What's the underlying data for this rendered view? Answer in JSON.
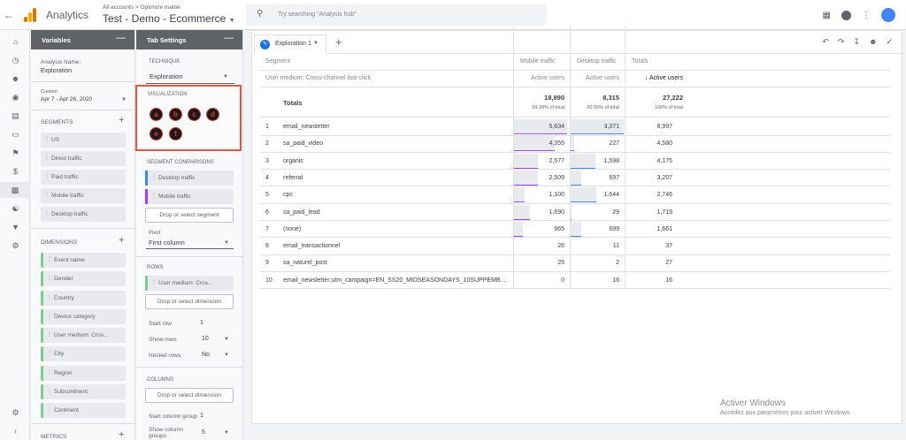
{
  "topbar": {
    "app_name": "Analytics",
    "breadcrumb": "All accounts > Optimize matter",
    "property": "Test - Demo - Ecommerce",
    "search_placeholder": "Try searching \"Analysis hub\""
  },
  "variables": {
    "title": "Variables",
    "analysis_name_label": "Analysis Name:",
    "analysis_name": "Exploration",
    "date_label": "Custom",
    "date_range": "Apr 7 - Apr 26, 2020",
    "segments_label": "SEGMENTS",
    "segments": [
      "US",
      "Direct traffic",
      "Paid traffic",
      "Mobile traffic",
      "Desktop traffic"
    ],
    "dimensions_label": "DIMENSIONS",
    "dimensions": [
      "Event name",
      "Gender",
      "Country",
      "Device category",
      "User medium: Cros...",
      "City",
      "Region",
      "Subcontinent",
      "Continent"
    ],
    "metrics_label": "METRICS"
  },
  "tab_settings": {
    "title": "Tab Settings",
    "technique_label": "TECHNIQUE",
    "technique": "Exploration",
    "visualization_label": "VISUALIZATION",
    "viz_options": [
      "a",
      "b",
      "c",
      "d",
      "e",
      "f"
    ],
    "segment_comparisons_label": "SEGMENT COMPARISONS",
    "segment_comparisons": [
      "Desktop traffic",
      "Mobile traffic"
    ],
    "drop_segment": "Drop or select segment",
    "pivot_label": "Pivot",
    "pivot": "First column",
    "rows_label": "ROWS",
    "row_dimension": "User medium: Cros...",
    "drop_dimension": "Drop or select dimension",
    "start_row_label": "Start row",
    "start_row": "1",
    "show_rows_label": "Show rows",
    "show_rows": "10",
    "nested_rows_label": "Nested rows",
    "nested_rows": "No",
    "columns_label": "COLUMNS",
    "drop_column_dimension": "Drop or select dimension",
    "start_column_group_label": "Start column group",
    "start_column_group": "1",
    "show_column_groups_label": "Show column groups",
    "show_column_groups": "5"
  },
  "exploration": {
    "tab_name": "Exploration 1",
    "segment_header": "Segment",
    "segments": [
      "Mobile traffic",
      "Desktop traffic",
      "Totals"
    ],
    "row_dimension_header": "User medium: Cross-channel last click",
    "metric_headers": [
      "Active users",
      "Active users",
      "↓ Active users"
    ],
    "totals_label": "Totals",
    "totals": [
      {
        "value": "18,890",
        "pct": "69.39% of total"
      },
      {
        "value": "8,315",
        "pct": "30.55% of total"
      },
      {
        "value": "27,222",
        "pct": "100% of total"
      }
    ],
    "rows": [
      {
        "n": "1",
        "name": "email_newsletter",
        "mobile": "5,634",
        "desktop": "3,371",
        "total": "8,997"
      },
      {
        "n": "2",
        "name": "sa_paid_video",
        "mobile": "4,355",
        "desktop": "227",
        "total": "4,580"
      },
      {
        "n": "3",
        "name": "organic",
        "mobile": "2,577",
        "desktop": "1,598",
        "total": "4,175"
      },
      {
        "n": "4",
        "name": "referral",
        "mobile": "2,509",
        "desktop": "697",
        "total": "3,207"
      },
      {
        "n": "5",
        "name": "cpc",
        "mobile": "1,100",
        "desktop": "1,644",
        "total": "2,746"
      },
      {
        "n": "6",
        "name": "sa_paid_lead",
        "mobile": "1,690",
        "desktop": "29",
        "total": "1,719"
      },
      {
        "n": "7",
        "name": "(none)",
        "mobile": "965",
        "desktop": "699",
        "total": "1,661"
      },
      {
        "n": "8",
        "name": "email_transactionnel",
        "mobile": "26",
        "desktop": "11",
        "total": "37"
      },
      {
        "n": "9",
        "name": "sa_naturel_post",
        "mobile": "25",
        "desktop": "2",
        "total": "27"
      },
      {
        "n": "10",
        "name": "email_newsletter;utm_campaign=EN_SS20_MIDSEASONDAYS_10SUPPEMB...",
        "mobile": "0",
        "desktop": "16",
        "total": "16"
      }
    ]
  },
  "watermark": {
    "title": "Activer Windows",
    "subtitle": "Accédez aux paramètres pour activer Windows."
  },
  "colors": {
    "mobile_bar_line": "#a142f4",
    "desktop_bar_line": "#4285f4",
    "viz_highlight": "#e8553e"
  }
}
